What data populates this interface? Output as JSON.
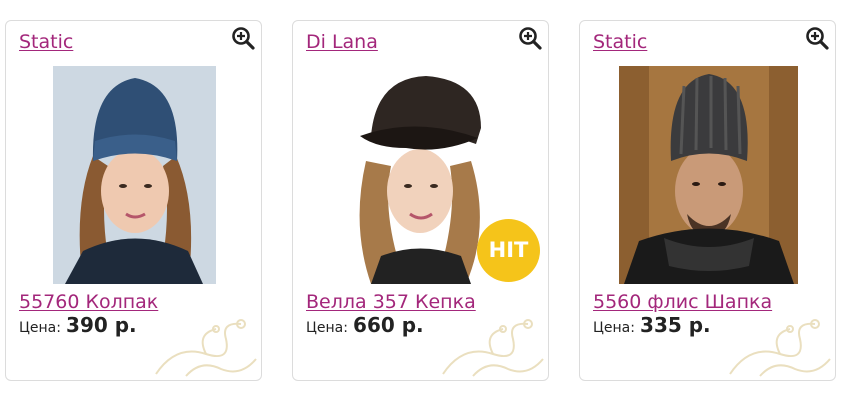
{
  "products": [
    {
      "brand": "Static",
      "title": "55760 Колпак",
      "price_label": "Цена:",
      "price_value": "390 р.",
      "badge": ""
    },
    {
      "brand": "Di Lana",
      "title": "Велла 357 Кепка",
      "price_label": "Цена:",
      "price_value": "660 р.",
      "badge": "HIT"
    },
    {
      "brand": "Static",
      "title": "5560 флис Шапка",
      "price_label": "Цена:",
      "price_value": "335 р.",
      "badge": ""
    }
  ],
  "icons": {
    "zoom": "zoom-in-icon",
    "ornament": "floral-ornament"
  },
  "colors": {
    "link": "#a3277b",
    "badge": "#f5c41a",
    "border": "#dcdcdc",
    "ornament": "#eadfbf"
  }
}
